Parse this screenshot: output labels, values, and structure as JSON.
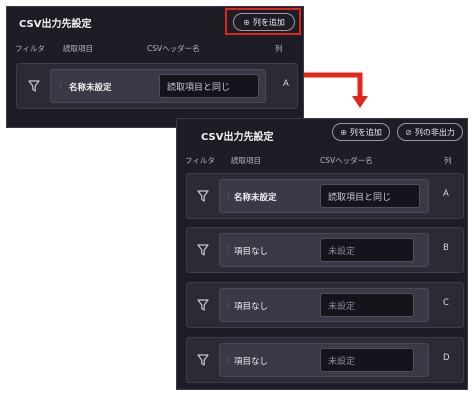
{
  "panel_before": {
    "title": "CSV出力先設定",
    "add_column_label": "列を追加",
    "headers": {
      "filter": "フィルタ",
      "read_item": "読取項目",
      "csv_header": "CSVヘッダー名",
      "column": "列"
    },
    "rows": [
      {
        "item": "名称未設定",
        "header_value": "読取項目と同じ",
        "column": "A"
      }
    ]
  },
  "panel_after": {
    "title": "CSV出力先設定",
    "add_column_label": "列を追加",
    "hide_column_label": "列の非出力",
    "headers": {
      "filter": "フィルタ",
      "read_item": "読取項目",
      "csv_header": "CSVヘッダー名",
      "column": "列"
    },
    "rows": [
      {
        "item": "名称未設定",
        "header_value": "読取項目と同じ",
        "column": "A"
      },
      {
        "item": "項目なし",
        "header_value": "未設定",
        "column": "B"
      },
      {
        "item": "項目なし",
        "header_value": "未設定",
        "column": "C"
      },
      {
        "item": "項目なし",
        "header_value": "未設定",
        "column": "D"
      }
    ]
  },
  "colors": {
    "highlight": "#e3261c",
    "panel_bg": "#1c1d25"
  },
  "icons": {
    "filter": "filter-funnel-icon",
    "add": "circle-plus-icon",
    "hide": "circle-slash-icon",
    "grip": "drag-grip-icon"
  }
}
